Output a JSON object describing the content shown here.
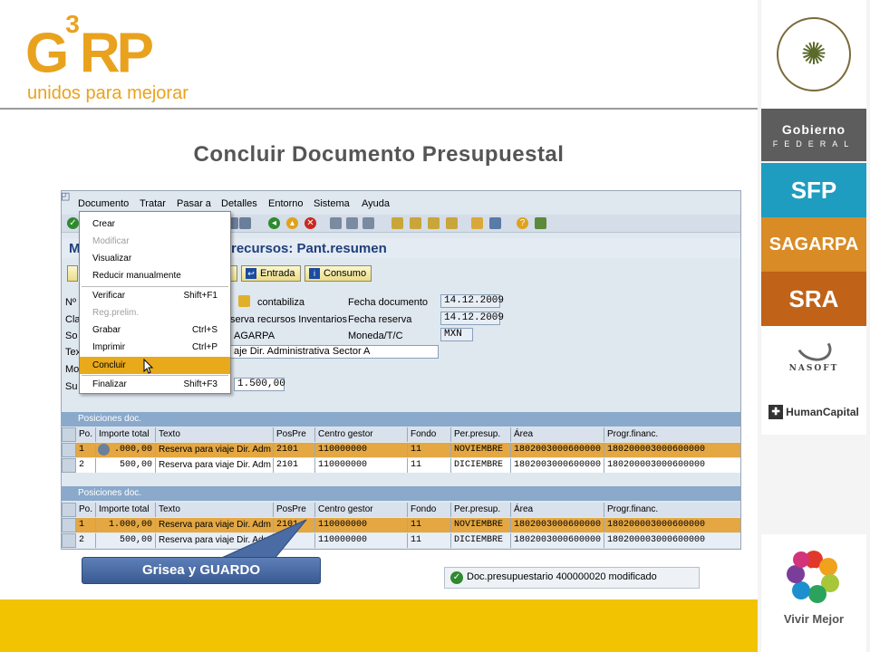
{
  "header": {
    "logo_main": "G",
    "logo_sup": "3",
    "logo_rest": "RP",
    "logo_sub": "unidos para mejorar",
    "title": "Concluir Documento Presupuestal"
  },
  "sidebar": {
    "gobierno": "Gobierno",
    "federal": "FEDERAL",
    "sfp": "SFP",
    "sagarpa": "SAGARPA",
    "sra": "SRA",
    "nasoft": "NASOFT",
    "humancapital": "HumanCapital",
    "vivir": "Vivir Mejor",
    "colors": {
      "sfp": "#1e9dc0",
      "sagarpa": "#d98b25",
      "sra": "#c06218",
      "gobierno": "#5d5d5d"
    }
  },
  "sap": {
    "menubar": [
      "Documento",
      "Tratar",
      "Pasar a",
      "Detalles",
      "Entorno",
      "Sistema",
      "Ayuda"
    ],
    "title_left": "M",
    "title_right": "recursos: Pant.resumen",
    "buttons": {
      "entrada": "Entrada",
      "consumo": "Consumo"
    },
    "labels": {
      "no": "Nº",
      "cla": "Cla",
      "so": "So",
      "tex": "Tex",
      "mo": "Mo",
      "su": "Su",
      "contabiliza": "contabiliza",
      "fecha_documento": "Fecha documento",
      "fecha_reserva": "Fecha reserva",
      "moneda": "Moneda/T/C"
    },
    "fields": {
      "clase_text": "serva recursos Inventarios",
      "soc_text": "AGARPA",
      "texto": "aje Dir. Administrativa Sector A",
      "fecha_documento": "14.12.2009",
      "fecha_reserva": "14.12.2009",
      "moneda": "MXN",
      "suma": "1.500,00"
    },
    "menu": {
      "items": [
        {
          "label": "Crear",
          "shortcut": "",
          "state": "normal"
        },
        {
          "label": "Modificar",
          "shortcut": "",
          "state": "disabled"
        },
        {
          "label": "Visualizar",
          "shortcut": "",
          "state": "normal"
        },
        {
          "label": "Reducir manualmente",
          "shortcut": "",
          "state": "normal"
        },
        {
          "label": "Verificar",
          "shortcut": "Shift+F1",
          "state": "normal"
        },
        {
          "label": "Reg.prelim.",
          "shortcut": "",
          "state": "disabled"
        },
        {
          "label": "Grabar",
          "shortcut": "Ctrl+S",
          "state": "normal"
        },
        {
          "label": "Imprimir",
          "shortcut": "Ctrl+P",
          "state": "normal"
        },
        {
          "label": "Concluir",
          "shortcut": "",
          "state": "selected"
        },
        {
          "label": "Finalizar",
          "shortcut": "Shift+F3",
          "state": "normal"
        }
      ]
    },
    "table_title": "Posiciones doc.",
    "columns": [
      "Po.",
      "Importe total",
      "Texto",
      "PosPre",
      "Centro gestor",
      "Fondo",
      "Per.presup.",
      "Área",
      "Progr.financ."
    ],
    "table1_rows": [
      [
        "1",
        ".000,00",
        "Reserva para viaje Dir. Adm",
        "2101",
        "110000000",
        "11",
        "NOVIEMBRE",
        "1802003000600000",
        "180200003000600000"
      ],
      [
        "2",
        "500,00",
        "Reserva para viaje Dir. Adm",
        "2101",
        "110000000",
        "11",
        "DICIEMBRE",
        "1802003000600000",
        "180200003000600000"
      ]
    ],
    "table2_rows": [
      [
        "1",
        "1.000,00",
        "Reserva para viaje Dir. Adm",
        "2101",
        "110000000",
        "11",
        "NOVIEMBRE",
        "1802003000600000",
        "180200003000600000"
      ],
      [
        "2",
        "500,00",
        "Reserva para viaje Dir. Adm",
        "21",
        "110000000",
        "11",
        "DICIEMBRE",
        "1802003000600000",
        "180200003000600000"
      ]
    ]
  },
  "callout": "Grisea y GUARDO",
  "status_message": "Doc.presupuestario 400000020 modificado"
}
